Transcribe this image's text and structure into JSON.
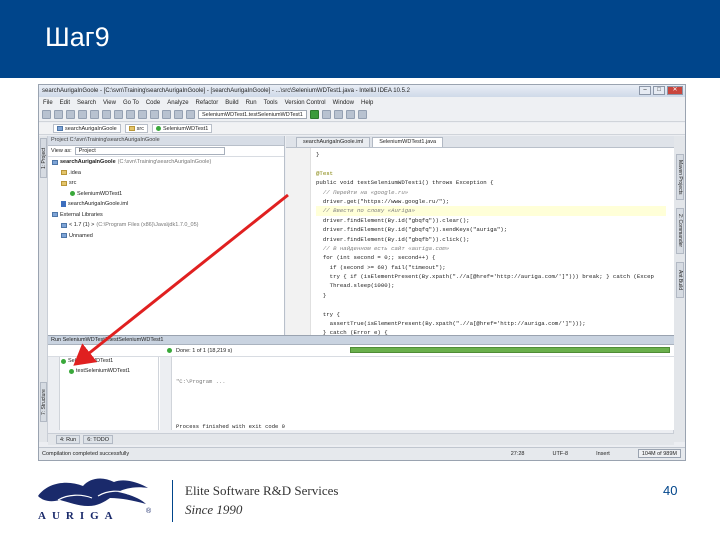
{
  "slide": {
    "title": "Шаг9",
    "page_number": "40"
  },
  "footer": {
    "company": "Elite Software R&D Services",
    "since": "Since 1990",
    "logo_text": "AURIGA",
    "logo_mark": "®"
  },
  "ide": {
    "window_title": "searchAurigaInGoole - [C:\\svn\\Training\\searchAurigaInGoole] - [searchAurigaInGoole] - ...\\src\\SeleniumWDTest1.java - IntelliJ IDEA 10.5.2",
    "window_buttons": [
      "–",
      "□",
      "✕"
    ],
    "menu": [
      "File",
      "Edit",
      "Search",
      "View",
      "Go To",
      "Code",
      "Analyze",
      "Refactor",
      "Build",
      "Run",
      "Tools",
      "Version Control",
      "Window",
      "Help"
    ],
    "run_config": "SeleniumWDTest1.testSeleniumWDTest1",
    "breadcrumbs": [
      "searchAurigaInGoole",
      "src",
      "SeleniumWDTest1"
    ],
    "left_tabs": [
      "1: Project",
      "7: Structure"
    ],
    "right_tabs": [
      "Maven Projects",
      "2: Commander",
      "Ant Build"
    ],
    "project_panel": {
      "header": "Project C:\\svn\\Training\\searchAurigaInGoole",
      "view_as_label": "View as:",
      "view_as_value": "Project",
      "tree": [
        {
          "label": "searchAurigaInGoole",
          "suffix": " (C:\\svn\\Training\\searchAurigaInGoole)",
          "level": 0,
          "kind": "module"
        },
        {
          "label": ".idea",
          "level": 1,
          "kind": "folder"
        },
        {
          "label": "src",
          "level": 1,
          "kind": "folder-src"
        },
        {
          "label": "SeleniumWDTest1",
          "level": 2,
          "kind": "class"
        },
        {
          "label": "searchAurigaInGoole.iml",
          "level": 1,
          "kind": "file"
        },
        {
          "label": "External Libraries",
          "level": 0,
          "kind": "lib"
        },
        {
          "label": "< 1.7 (1) >",
          "suffix": " (C:\\Program Files (x86)\\Java\\jdk1.7.0_05)",
          "level": 1,
          "kind": "lib"
        },
        {
          "label": "Unnamed",
          "level": 1,
          "kind": "lib"
        }
      ]
    },
    "editor": {
      "tabs": [
        "searchAurigaInGoole.iml",
        "SeleniumWDTest1.java"
      ],
      "active_tab": 1,
      "lines": [
        "}",
        "",
        "@Test",
        "public void testSeleniumWDTest1() throws Exception {",
        "  // Перейти на «google.ru»",
        "  driver.get(\"https://www.google.ru/\");",
        "  // Ввести по слову «Auriga»",
        "  driver.findElement(By.id(\"gbqfq\")).clear();",
        "  driver.findElement(By.id(\"gbqfq\")).sendKeys(\"auriga\");",
        "  driver.findElement(By.id(\"gbqfb\")).click();",
        "  // В найденном есть сайт «auriga.com»",
        "  for (int second = 0;; second++) {",
        "    if (second >= 60) fail(\"timeout\");",
        "    try { if (isElementPresent(By.xpath(\".//a[@href='http://auriga.com/']\"))) break; } catch (Excep",
        "    Thread.sleep(1000);",
        "  }",
        "",
        "  try {",
        "    assertTrue(isElementPresent(By.xpath(\".//a[@href='http://auriga.com/']\")));",
        "  } catch (Error e) {"
      ]
    },
    "run_panel": {
      "header": "Run SeleniumWDTest1.testSeleniumWDTest1",
      "status": "Done: 1 of 1 (18,219 s)",
      "progress": 1.0,
      "tree": [
        "SeleniumWDTest1",
        "testSeleniumWDTest1"
      ],
      "console": [
        "\"C:\\Program ...",
        "",
        "Process finished with exit code 0"
      ]
    },
    "bottom_tabs": [
      "4: Run",
      "6: TODO"
    ],
    "status": {
      "message": "Compilation completed successfully",
      "position": "27:28",
      "encoding": "UTF-8",
      "mode": "Insert",
      "memory": "104M of 989M"
    }
  },
  "colors": {
    "header_bg": "#00458b",
    "arrow": "#e02020",
    "ok": "#39a83a"
  }
}
